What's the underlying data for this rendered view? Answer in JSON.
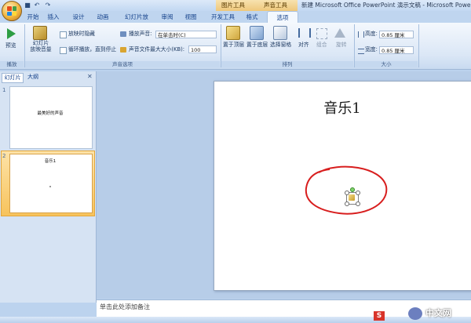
{
  "app": {
    "window_title": "新建 Microsoft Office PowerPoint 演示文稿 - Microsoft PowerPoint",
    "contextual_tabs": [
      "图片工具",
      "声音工具"
    ]
  },
  "tabs": [
    "开始",
    "插入",
    "设计",
    "动画",
    "幻灯片放映",
    "审阅",
    "视图",
    "开发工具",
    "格式",
    "选项"
  ],
  "active_tab": "选项",
  "ribbon": {
    "preview": {
      "button": "预览",
      "group": "播放"
    },
    "sound_options": {
      "slideshow_volume": "幻灯片\n放映音量",
      "hide_during_show": "放映时隐藏",
      "loop_until_stopped": "循环播放，直到停止",
      "play_sound_label": "播放声音:",
      "play_sound_value": "在单击时(C)",
      "max_file_size_label": "声音文件最大大小(KB):",
      "max_file_size_value": "100",
      "group": "声音选项"
    },
    "arrange": {
      "bring_forward": "置于顶层",
      "send_backward": "置于底层",
      "selection_pane": "选择窗格",
      "align": "对齐",
      "group": "组合",
      "rotate": "旋转",
      "group_title": "排列"
    },
    "size": {
      "height_label": "高度:",
      "height_value": "0.85 厘米",
      "width_label": "宽度:",
      "width_value": "0.85 厘米",
      "group_title": "大小"
    }
  },
  "left_pane": {
    "tabs": [
      "幻灯片",
      "大纲"
    ],
    "slides": [
      {
        "num": "1",
        "title": "最美好的声音"
      },
      {
        "num": "2",
        "title": "音乐1"
      }
    ]
  },
  "slide": {
    "title": "音乐1"
  },
  "notes": {
    "placeholder": "单击此处添加备注"
  },
  "colors": {
    "annotation": "#d81e1e",
    "accent": "#15428b",
    "selected_thumb": "#f7c35c"
  },
  "icons": [
    "office-button-icon",
    "save-icon",
    "undo-icon",
    "redo-icon",
    "play-icon",
    "volume-icon",
    "speaker-icon"
  ],
  "watermark": "中文网"
}
